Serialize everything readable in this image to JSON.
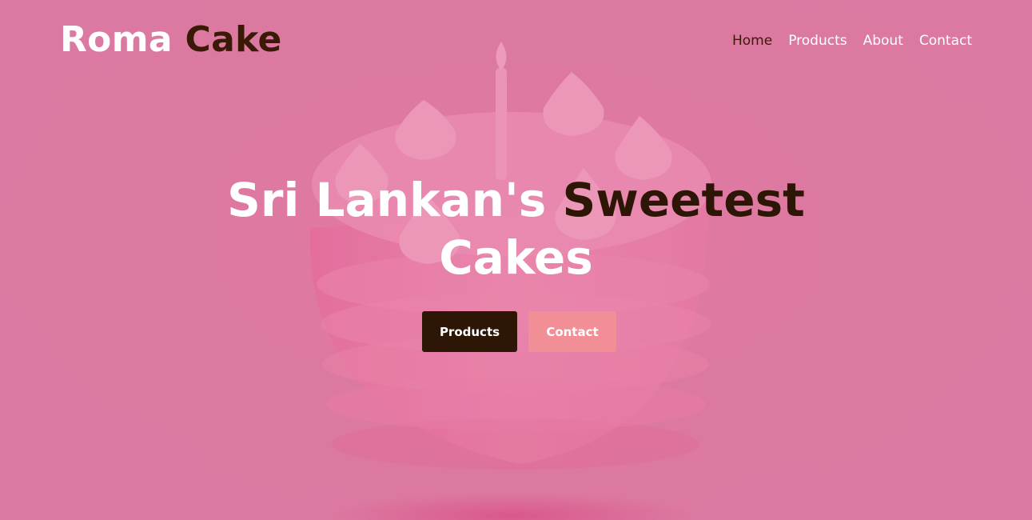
{
  "brand": {
    "name_part1": "Roma",
    "name_part2": "Cake"
  },
  "nav": {
    "items": [
      {
        "label": "Home",
        "active": true
      },
      {
        "label": "Products",
        "active": false
      },
      {
        "label": "About",
        "active": false
      },
      {
        "label": "Contact",
        "active": false
      }
    ]
  },
  "hero": {
    "headline_white": "Sri Lankan's",
    "headline_brown_1": "Sweetest",
    "headline_white_2": "Cakes",
    "primary_button": "Products",
    "secondary_button": "Contact",
    "background_image": "pink-layered-birthday-cake-with-candle"
  },
  "colors": {
    "brand_brown": "#2e1606",
    "accent_pink": "#f28f96",
    "background_pink": "#dc7aa0",
    "text_white": "#ffffff"
  }
}
